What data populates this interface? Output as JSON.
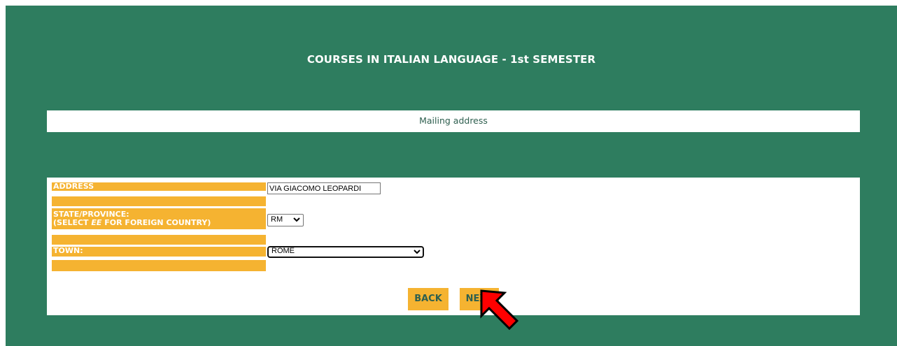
{
  "header": {
    "title": "COURSES IN ITALIAN LANGUAGE - 1st SEMESTER"
  },
  "section": {
    "title": "Mailing address"
  },
  "form": {
    "address_label": "ADDRESS",
    "address_value": "VIA GIACOMO LEOPARDI",
    "state_label_line1": "STATE/PROVINCE:",
    "state_label_line2_prefix": "(SELECT ",
    "state_label_line2_em": "EE",
    "state_label_line2_suffix": " FOR FOREIGN COUNTRY)",
    "state_value": "RM",
    "town_label": "TOWN:",
    "town_value": "ROME"
  },
  "buttons": {
    "back_label": "BACK",
    "next_label": "NEXT"
  },
  "colors": {
    "background": "#2e7d5f",
    "label_bg": "#f5b331",
    "annotation_arrow": "#ff0000"
  },
  "icons": {
    "state_select": "chevron-down-icon",
    "town_select": "chevron-down-icon",
    "annotation": "red-arrow-pointer-icon"
  }
}
